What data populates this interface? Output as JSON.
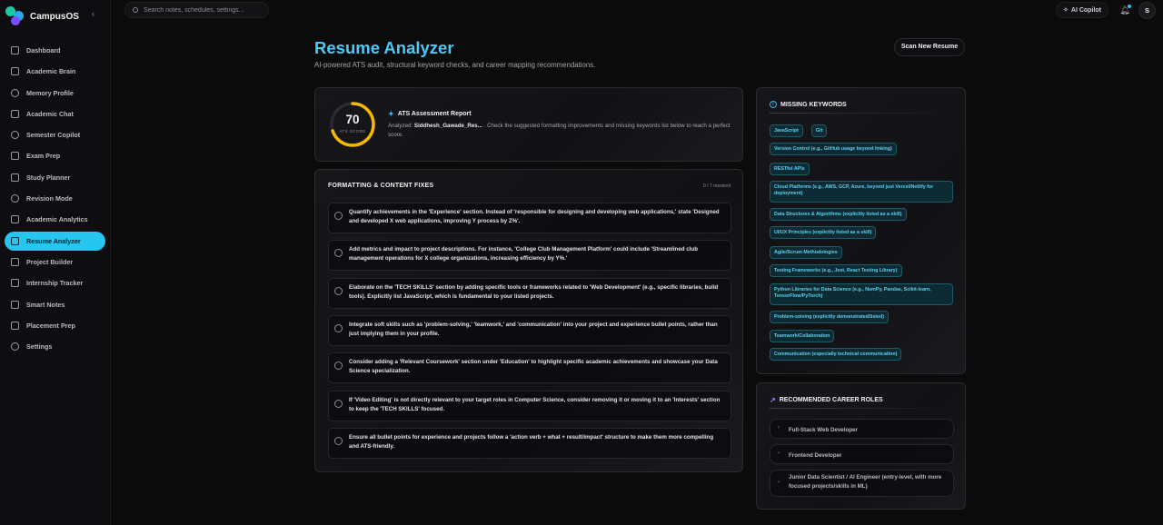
{
  "app": {
    "name": "CampusOS"
  },
  "sidebar": {
    "items": [
      {
        "label": "Dashboard",
        "icon": "grid-icon"
      },
      {
        "label": "Academic Brain",
        "icon": "database-icon"
      },
      {
        "label": "Memory Profile",
        "icon": "brain-icon"
      },
      {
        "label": "Academic Chat",
        "icon": "chat-icon"
      },
      {
        "label": "Semester Copilot",
        "icon": "compass-icon"
      },
      {
        "label": "Exam Prep",
        "icon": "flame-icon"
      },
      {
        "label": "Study Planner",
        "icon": "calendar-icon"
      },
      {
        "label": "Revision Mode",
        "icon": "refresh-icon"
      },
      {
        "label": "Academic Analytics",
        "icon": "chart-icon"
      },
      {
        "label": "Resume Analyzer",
        "icon": "document-icon",
        "active": true
      },
      {
        "label": "Project Builder",
        "icon": "box-icon"
      },
      {
        "label": "Internship Tracker",
        "icon": "briefcase-icon"
      },
      {
        "label": "Smart Notes",
        "icon": "notes-icon"
      },
      {
        "label": "Placement Prep",
        "icon": "cap-icon"
      },
      {
        "label": "Settings",
        "icon": "gear-icon"
      }
    ]
  },
  "topbar": {
    "search_placeholder": "Search notes, schedules, settings...",
    "copilot_label": "AI Copilot",
    "avatar_initial": "S"
  },
  "header": {
    "title": "Resume Analyzer",
    "subtitle": "AI-powered ATS audit, structural keyword checks, and career mapping recommendations.",
    "scan_button": "Scan New Resume"
  },
  "ats": {
    "score": "70",
    "score_label": "ATS SCORE",
    "score_value": 70,
    "report_title": "ATS Assessment Report",
    "analyzed_label": "Analyzed:",
    "file_name": "Siddhesh_Gawade_Res...",
    "description": ". Check the suggested formatting improvements and missing keywords list below to reach a perfect score."
  },
  "fixes": {
    "title": "FORMATTING & CONTENT FIXES",
    "count": "0 / 7 resolved",
    "items": [
      "Quantify achievements in the 'Experience' section. Instead of 'responsible for designing and developing web applications,' state 'Designed and developed X web applications, improving Y process by Z%'.",
      "Add metrics and impact to project descriptions. For instance, 'College Club Management Platform' could include 'Streamlined club management operations for X college organizations, increasing efficiency by Y%.'",
      "Elaborate on the 'TECH SKILLS' section by adding specific tools or frameworks related to 'Web Development' (e.g., specific libraries, build tools). Explicitly list JavaScript, which is fundamental to your listed projects.",
      "Integrate soft skills such as 'problem-solving,' 'teamwork,' and 'communication' into your project and experience bullet points, rather than just implying them in your profile.",
      "Consider adding a 'Relevant Coursework' section under 'Education' to highlight specific academic achievements and showcase your Data Science specialization.",
      "If 'Video Editing' is not directly relevant to your target roles in Computer Science, consider removing it or moving it to an 'Interests' section to keep the 'TECH SKILLS' focused.",
      "Ensure all bullet points for experience and projects follow a 'action verb + what + result/impact' structure to make them more compelling and ATS-friendly."
    ]
  },
  "keywords": {
    "title": "MISSING KEYWORDS",
    "items": [
      "JavaScript",
      "Git",
      "Version Control (e.g., GitHub usage beyond linking)",
      "RESTful APIs",
      "Cloud Platforms (e.g., AWS, GCP, Azure, beyond just Vercel/Netlify for deployment)",
      "Data Structures & Algorithms (explicitly listed as a skill)",
      "UI/UX Principles (explicitly listed as a skill)",
      "Agile/Scrum Methodologies",
      "Testing Frameworks (e.g., Jest, React Testing Library)",
      "Python Libraries for Data Science (e.g., NumPy, Pandas, Scikit-learn, TensorFlow/PyTorch)",
      "Problem-solving (explicitly demonstrated/listed)",
      "Teamwork/Collaboration",
      "Communication (especially technical communication)"
    ]
  },
  "roles": {
    "title": "RECOMMENDED CAREER ROLES",
    "items": [
      "Full-Stack Web Developer",
      "Frontend Developer",
      "Junior Data Scientist / AI Engineer (entry-level, with more focused projects/skills in ML)"
    ]
  },
  "colors": {
    "accent": "#26c6f0",
    "gauge": "#f5b800",
    "tag_text": "#5fd0ef"
  }
}
